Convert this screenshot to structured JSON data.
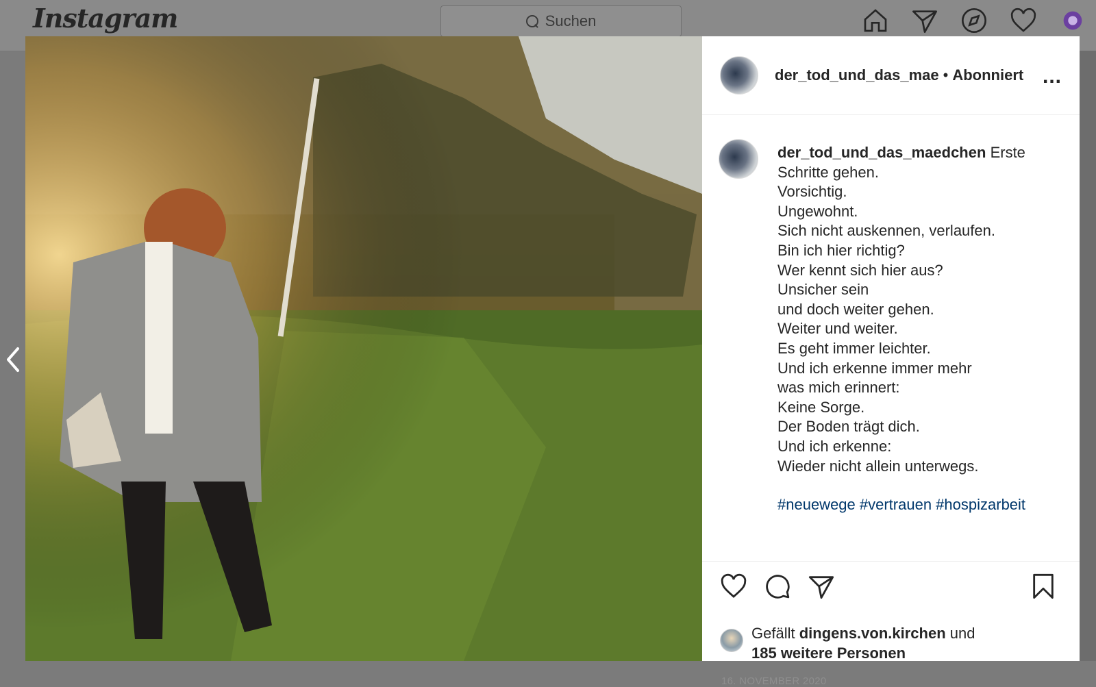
{
  "app": {
    "logo": "Instagram",
    "search_placeholder": "Suchen",
    "nav_icons": [
      "home-icon",
      "send-icon",
      "explore-icon",
      "heart-icon",
      "avatar-icon"
    ]
  },
  "post": {
    "header": {
      "username": "der_tod_und_das_mae",
      "separator": "•",
      "follow_status": "Abonniert",
      "more": "..."
    },
    "caption": {
      "username": "der_tod_und_das_maedchen",
      "lines": [
        "Erste",
        "Schritte gehen.",
        "Vorsichtig.",
        "Ungewohnt.",
        "Sich nicht auskennen, verlaufen.",
        "Bin ich hier richtig?",
        "Wer kennt sich hier aus?",
        "Unsicher sein",
        "und doch weiter gehen.",
        "Weiter und weiter.",
        "Es geht immer leichter.",
        "Und ich erkenne immer mehr",
        "was mich erinnert:",
        "Keine Sorge.",
        "Der Boden trägt dich.",
        "Und ich erkenne:",
        "Wieder nicht allein unterwegs."
      ],
      "hashtags": "#neuewege #vertrauen #hospizarbeit"
    },
    "likes": {
      "prefix": "Gefällt",
      "user": "dingens.von.kirchen",
      "connector": "und",
      "others": "185 weitere Personen"
    },
    "date": "16. NOVEMBER 2020"
  }
}
